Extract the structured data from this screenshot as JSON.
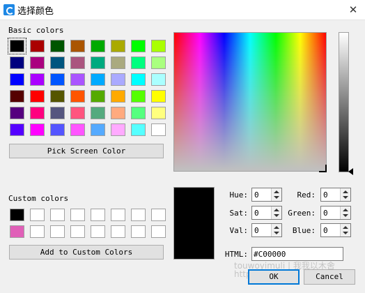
{
  "window": {
    "title": "选择颜色",
    "close_glyph": "✕"
  },
  "basic": {
    "label": "Basic colors",
    "colors": [
      [
        "#000000",
        "#aa0000",
        "#005500",
        "#aa5500",
        "#00aa00",
        "#aaaa00",
        "#00ff00",
        "#aaff00"
      ],
      [
        "#00007f",
        "#aa007f",
        "#00557f",
        "#aa557f",
        "#00aa7f",
        "#aaaa7f",
        "#00ff7f",
        "#aaff7f"
      ],
      [
        "#0000ff",
        "#aa00ff",
        "#0055ff",
        "#aa55ff",
        "#00aaff",
        "#aaaaff",
        "#00ffff",
        "#aaffff"
      ],
      [
        "#550000",
        "#ff0000",
        "#555500",
        "#ff5500",
        "#55aa00",
        "#ffaa00",
        "#55ff00",
        "#ffff00"
      ],
      [
        "#55007f",
        "#ff007f",
        "#55557f",
        "#ff557f",
        "#55aa7f",
        "#ffaa7f",
        "#55ff7f",
        "#ffff7f"
      ],
      [
        "#5500ff",
        "#ff00ff",
        "#5555ff",
        "#ff55ff",
        "#55aaff",
        "#ffaaff",
        "#55ffff",
        "#ffffff"
      ]
    ]
  },
  "pick_screen_label": "Pick Screen Color",
  "custom": {
    "label": "Custom colors",
    "row1": [
      "#000000",
      "#ffffff",
      "#ffffff",
      "#ffffff",
      "#ffffff",
      "#ffffff",
      "#ffffff",
      "#ffffff"
    ],
    "row2": [
      "#e060b8",
      "#ffffff",
      "#ffffff",
      "#ffffff",
      "#ffffff",
      "#ffffff",
      "#ffffff",
      "#ffffff"
    ]
  },
  "add_custom_label": "Add to Custom Colors",
  "fields": {
    "hue": {
      "label": "Hue:",
      "value": "0"
    },
    "sat": {
      "label": "Sat:",
      "value": "0"
    },
    "val": {
      "label": "Val:",
      "value": "0"
    },
    "red": {
      "label": "Red:",
      "value": "0"
    },
    "green": {
      "label": "Green:",
      "value": "0"
    },
    "blue": {
      "label": "Blue:",
      "value": "0"
    },
    "html": {
      "label": "HTML:",
      "value": "#C00000"
    }
  },
  "buttons": {
    "ok": "OK",
    "cancel": "Cancel"
  },
  "watermark": {
    "line1": "touwoyimuli | 我我以木舍",
    "line2": "http"
  }
}
